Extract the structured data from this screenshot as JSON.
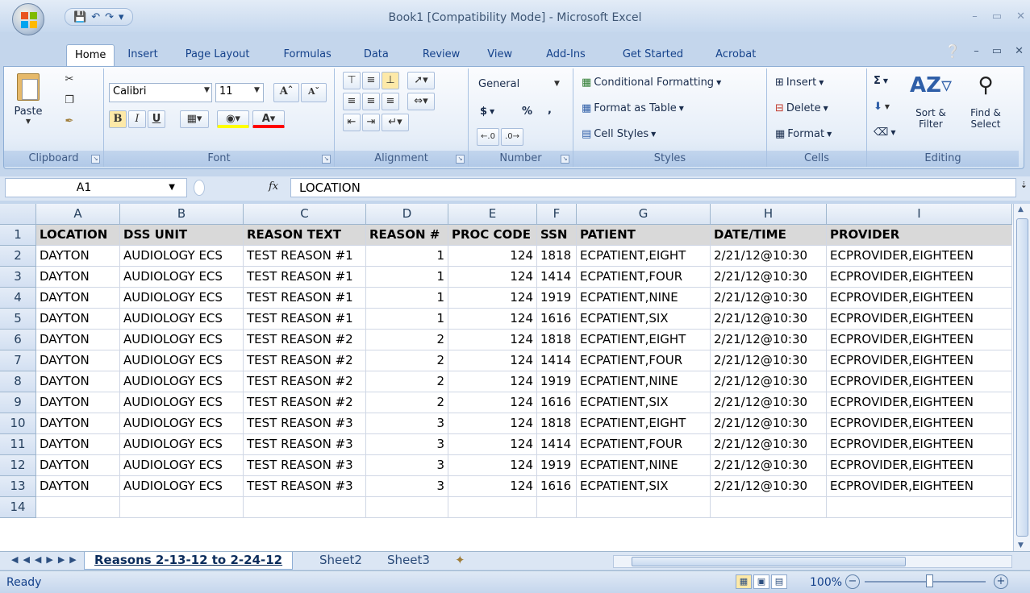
{
  "window": {
    "title": "Book1  [Compatibility Mode] - Microsoft Excel"
  },
  "tabs": [
    "Home",
    "Insert",
    "Page Layout",
    "Formulas",
    "Data",
    "Review",
    "View",
    "Add-Ins",
    "Get Started",
    "Acrobat"
  ],
  "active_tab": "Home",
  "ribbon": {
    "clipboard": {
      "label": "Clipboard",
      "paste": "Paste"
    },
    "font": {
      "label": "Font",
      "name": "Calibri",
      "size": "11"
    },
    "alignment": {
      "label": "Alignment"
    },
    "number": {
      "label": "Number",
      "format": "General",
      "currency": "$",
      "percent": "%",
      "comma": ","
    },
    "styles": {
      "label": "Styles",
      "conditional": "Conditional Formatting",
      "format_table": "Format as Table",
      "cell_styles": "Cell Styles"
    },
    "cells": {
      "label": "Cells",
      "insert": "Insert",
      "delete": "Delete",
      "format": "Format"
    },
    "editing": {
      "label": "Editing",
      "sort_filter": "Sort & Filter",
      "find_select": "Find & Select"
    }
  },
  "formula_bar": {
    "name_box": "A1",
    "fx": "fx",
    "value": "LOCATION"
  },
  "columns": [
    "A",
    "B",
    "C",
    "D",
    "E",
    "F",
    "G",
    "H",
    "I"
  ],
  "sheet": {
    "header": [
      "LOCATION",
      "DSS UNIT",
      "REASON TEXT",
      "REASON #",
      "PROC CODE",
      "SSN",
      "PATIENT",
      "DATE/TIME",
      "PROVIDER"
    ],
    "rows": [
      [
        "DAYTON",
        "AUDIOLOGY ECS",
        "TEST REASON #1",
        "1",
        "124",
        "1818",
        "ECPATIENT,EIGHT",
        "2/21/12@10:30",
        "ECPROVIDER,EIGHTEEN"
      ],
      [
        "DAYTON",
        "AUDIOLOGY ECS",
        "TEST REASON #1",
        "1",
        "124",
        "1414",
        "ECPATIENT,FOUR",
        "2/21/12@10:30",
        "ECPROVIDER,EIGHTEEN"
      ],
      [
        "DAYTON",
        "AUDIOLOGY ECS",
        "TEST REASON #1",
        "1",
        "124",
        "1919",
        "ECPATIENT,NINE",
        "2/21/12@10:30",
        "ECPROVIDER,EIGHTEEN"
      ],
      [
        "DAYTON",
        "AUDIOLOGY ECS",
        "TEST REASON #1",
        "1",
        "124",
        "1616",
        "ECPATIENT,SIX",
        "2/21/12@10:30",
        "ECPROVIDER,EIGHTEEN"
      ],
      [
        "DAYTON",
        "AUDIOLOGY ECS",
        "TEST REASON #2",
        "2",
        "124",
        "1818",
        "ECPATIENT,EIGHT",
        "2/21/12@10:30",
        "ECPROVIDER,EIGHTEEN"
      ],
      [
        "DAYTON",
        "AUDIOLOGY ECS",
        "TEST REASON #2",
        "2",
        "124",
        "1414",
        "ECPATIENT,FOUR",
        "2/21/12@10:30",
        "ECPROVIDER,EIGHTEEN"
      ],
      [
        "DAYTON",
        "AUDIOLOGY ECS",
        "TEST REASON #2",
        "2",
        "124",
        "1919",
        "ECPATIENT,NINE",
        "2/21/12@10:30",
        "ECPROVIDER,EIGHTEEN"
      ],
      [
        "DAYTON",
        "AUDIOLOGY ECS",
        "TEST REASON #2",
        "2",
        "124",
        "1616",
        "ECPATIENT,SIX",
        "2/21/12@10:30",
        "ECPROVIDER,EIGHTEEN"
      ],
      [
        "DAYTON",
        "AUDIOLOGY ECS",
        "TEST REASON #3",
        "3",
        "124",
        "1818",
        "ECPATIENT,EIGHT",
        "2/21/12@10:30",
        "ECPROVIDER,EIGHTEEN"
      ],
      [
        "DAYTON",
        "AUDIOLOGY ECS",
        "TEST REASON #3",
        "3",
        "124",
        "1414",
        "ECPATIENT,FOUR",
        "2/21/12@10:30",
        "ECPROVIDER,EIGHTEEN"
      ],
      [
        "DAYTON",
        "AUDIOLOGY ECS",
        "TEST REASON #3",
        "3",
        "124",
        "1919",
        "ECPATIENT,NINE",
        "2/21/12@10:30",
        "ECPROVIDER,EIGHTEEN"
      ],
      [
        "DAYTON",
        "AUDIOLOGY ECS",
        "TEST REASON #3",
        "3",
        "124",
        "1616",
        "ECPATIENT,SIX",
        "2/21/12@10:30",
        "ECPROVIDER,EIGHTEEN"
      ]
    ]
  },
  "sheet_tabs": [
    "Reasons 2-13-12 to 2-24-12",
    "Sheet2",
    "Sheet3"
  ],
  "status": {
    "ready": "Ready",
    "zoom": "100%"
  }
}
